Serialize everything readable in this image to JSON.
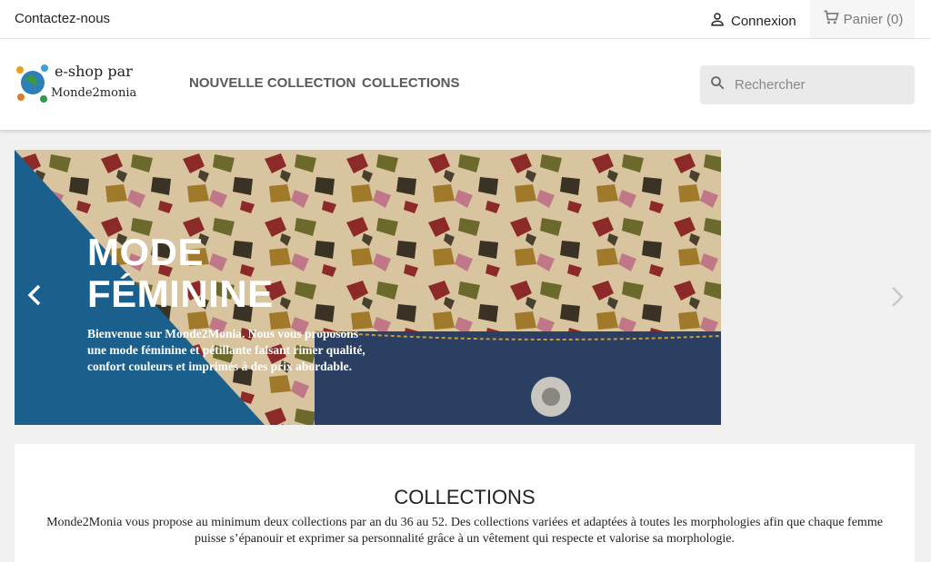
{
  "topbar": {
    "contact": "Contactez-nous",
    "login": "Connexion",
    "cart": "Panier",
    "cart_count": "(0)"
  },
  "header": {
    "logo_line1": "e-shop par",
    "logo_line2": "Monde2monia",
    "nav": [
      "NOUVELLE COLLECTION",
      "COLLECTIONS"
    ],
    "search_placeholder": "Rechercher"
  },
  "slider": {
    "title_line1": "MODE",
    "title_line2": "FÉMININE",
    "text": "Bienvenue sur Monde2Monia. Nous vous proposons une mode féminine et pétillante faisant rimer qualité, confort couleurs et imprimés à des prix abordable."
  },
  "collections": {
    "title": "COLLECTIONS",
    "text": "Monde2Monia vous propose au minimum deux collections par an du 36 au 52. Des collections variées et adaptées à toutes les morphologies afin que chaque femme puisse s’épanouir et exprimer sa personnalité grâce à un vêtement qui respecte et valorise sa morphologie."
  },
  "colors": {
    "banner_blue": "#1b5f8c",
    "denim": "#2b3f63"
  }
}
